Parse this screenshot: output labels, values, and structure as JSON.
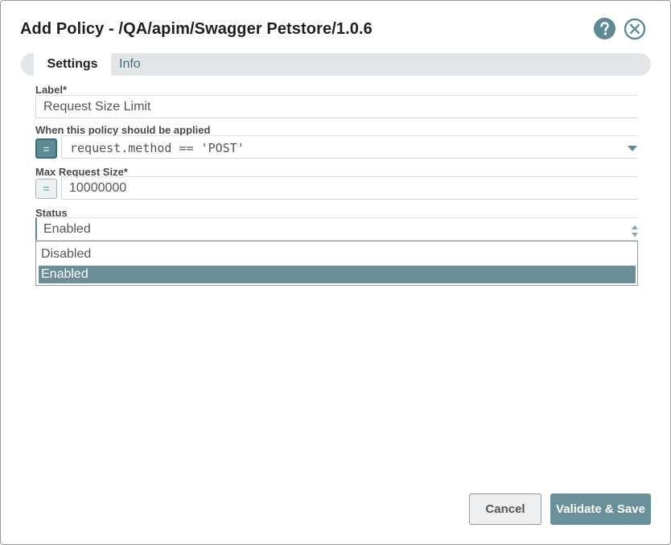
{
  "dialog": {
    "title": "Add Policy - /QA/apim/Swagger Petstore/1.0.6"
  },
  "header_icons": {
    "help": "help-icon",
    "close": "close-icon"
  },
  "tabs": [
    {
      "label": "Settings",
      "active": true
    },
    {
      "label": "Info",
      "active": false
    }
  ],
  "fields": {
    "label": {
      "label": "Label*",
      "value": "Request Size Limit"
    },
    "condition": {
      "label": "When this policy should be applied",
      "value": "request.method == 'POST'",
      "expression_mode": true
    },
    "max_size": {
      "label": "Max Request Size*",
      "value": "10000000",
      "expression_mode": false
    },
    "status": {
      "label": "Status",
      "value": "Enabled",
      "options": [
        "Disabled",
        "Enabled"
      ],
      "selected": "Enabled"
    }
  },
  "expr_toggle_symbol": "=",
  "buttons": {
    "cancel": "Cancel",
    "save": "Validate & Save"
  },
  "colors": {
    "accent": "#5d8a94",
    "selected_option": "#6a8f99",
    "primary_button": "#6a909a"
  }
}
